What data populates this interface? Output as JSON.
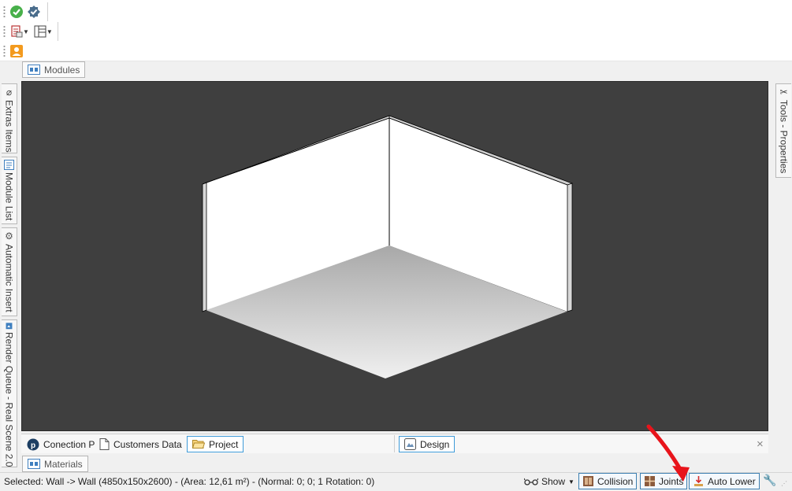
{
  "toolbar": {
    "row1": [
      {
        "icon": "check-circle-icon"
      },
      {
        "icon": "badge-check-icon"
      }
    ],
    "row2": [
      {
        "icon": "print-layout-icon"
      },
      {
        "icon": "columns-layout-icon"
      }
    ],
    "row3": [
      {
        "icon": "user-orange-icon"
      }
    ]
  },
  "top_tab": {
    "label": "Modules"
  },
  "left_tabs": [
    {
      "label": "Extras Items",
      "icon": "paperclip-icon"
    },
    {
      "label": "Module List",
      "icon": "list-icon"
    },
    {
      "label": "Automatic Insert",
      "icon": "wrench-icon"
    },
    {
      "label": "Render Queue - Real Scene 2.0",
      "icon": "render-icon"
    }
  ],
  "right_tab": {
    "label": "Tools - Properties",
    "icon": "tools-icon"
  },
  "viewport": {
    "background": "#3f3f3f",
    "description_wall_color": "#ffffff"
  },
  "bottom_tabs": {
    "left": [
      {
        "label": "Conection P",
        "icon": "p-circle-icon",
        "selected": false
      },
      {
        "label": "Customers Data",
        "icon": "document-icon",
        "selected": false
      },
      {
        "label": "Project",
        "icon": "folder-open-icon",
        "selected": true
      }
    ],
    "right": [
      {
        "label": "Design",
        "icon": "design-icon",
        "selected": true
      }
    ],
    "close": "×"
  },
  "materials_tab": {
    "label": "Materials"
  },
  "status": {
    "selected_text": "Selected: Wall -> Wall (4850x150x2600) - (Area: 12,61 m²) - (Normal: 0; 0; 1 Rotation: 0)",
    "show_label": "Show",
    "collision_label": "Collision",
    "joints_label": "Joints",
    "auto_lower_label": "Auto Lower"
  },
  "colors": {
    "accent": "#3f9bd9",
    "arrow": "#e8141b",
    "orange": "#f39a1e"
  }
}
